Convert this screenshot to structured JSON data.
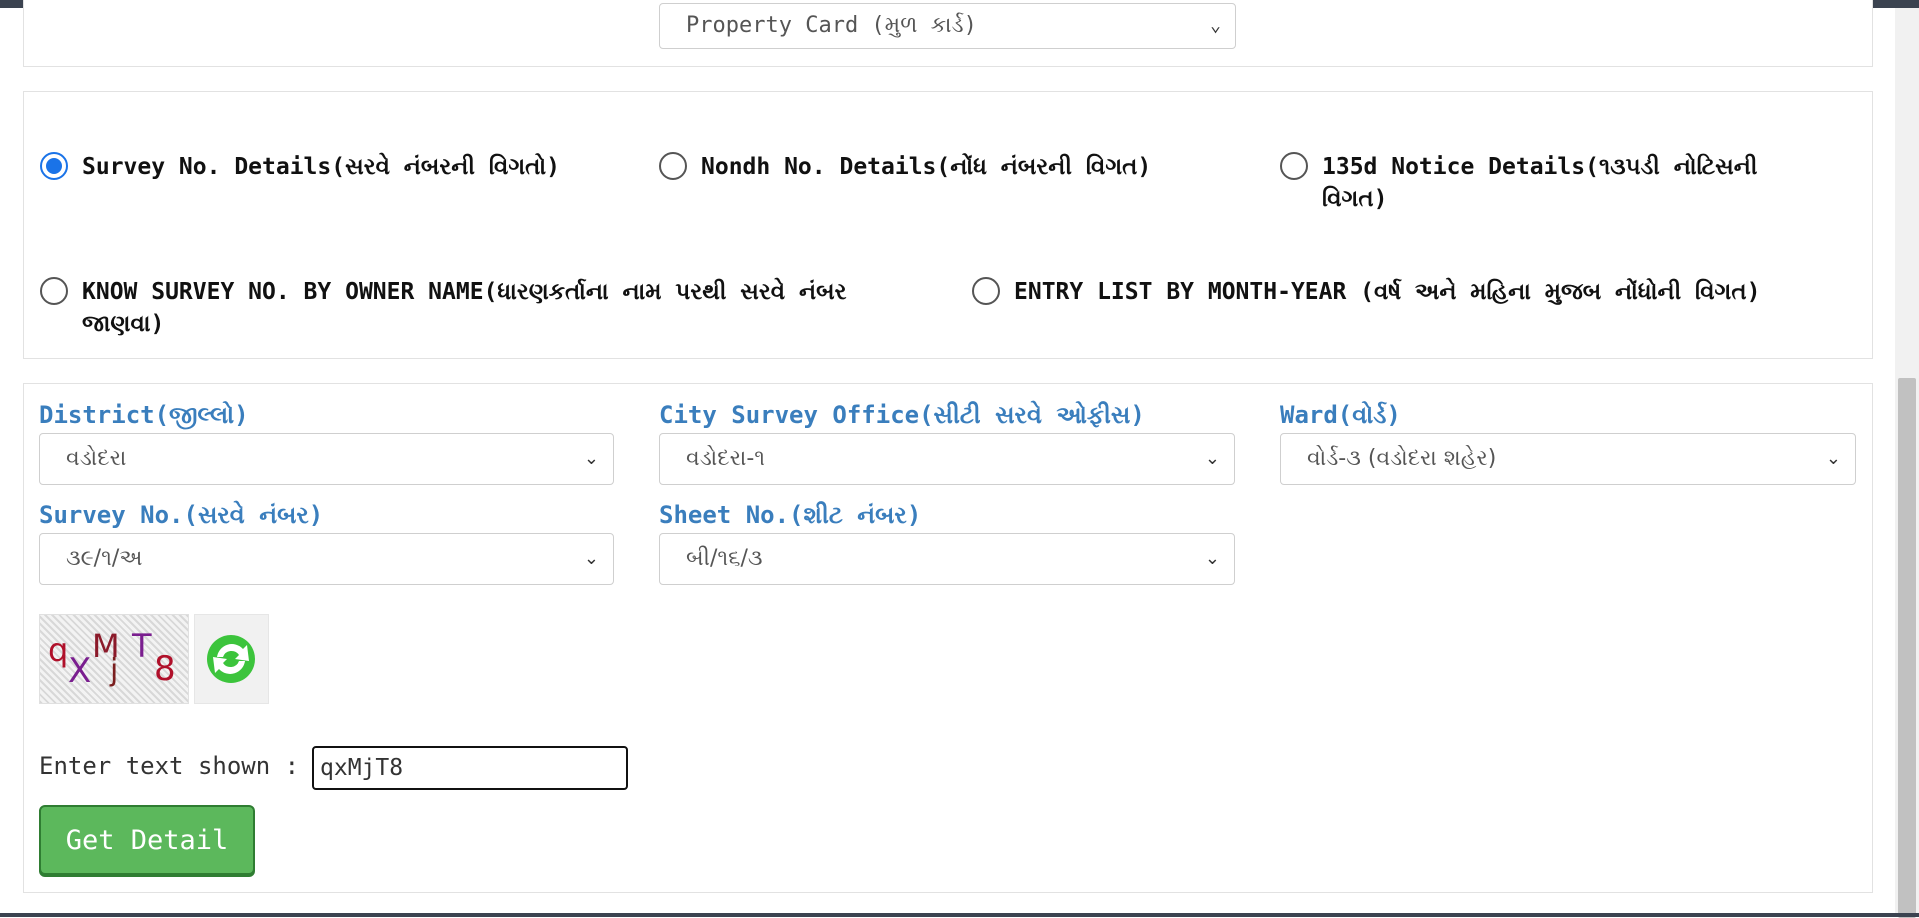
{
  "top": {
    "report_select": {
      "value": "Property Card (મુળ કાર્ડ)"
    }
  },
  "search_type": {
    "options": [
      {
        "label": "Survey No. Details(સરવે નંબરની વિગતો)",
        "checked": true
      },
      {
        "label": "Nondh No. Details(નોંધ નંબરની વિગત)",
        "checked": false
      },
      {
        "label": "135d Notice Details(૧૩૫ડી નોટિસની વિગત)",
        "checked": false
      },
      {
        "label": "KNOW SURVEY NO. BY OWNER NAME(ધારણકર્તાના નામ પરથી સરવે નંબર જાણવા)",
        "checked": false
      },
      {
        "label": "ENTRY LIST BY MONTH-YEAR (વર્ષ અને મહિના મુજબ નોંધોની વિગત)",
        "checked": false
      }
    ]
  },
  "form": {
    "district": {
      "label": "District(જીલ્લો)",
      "value": "વડોદરા"
    },
    "city_survey_office": {
      "label": "City Survey Office(સીટી સરવે ઓફીસ)",
      "value": "વડોદરા-૧"
    },
    "ward": {
      "label": "Ward(વોર્ડ)",
      "value": "વોર્ડ-૩ (વડોદરા શહેર)"
    },
    "survey_no": {
      "label": "Survey No.(સરવે નંબર)",
      "value": "૩૯/૧/અ"
    },
    "sheet_no": {
      "label": "Sheet No.(શીટ નંબર)",
      "value": "બી/૧૬/૩"
    }
  },
  "captcha": {
    "image_text": "qXMjT8",
    "refresh_icon": "refresh-icon",
    "enter_label": "Enter text shown :",
    "input_value": "qxMjT8"
  },
  "actions": {
    "get_detail_label": "Get Detail"
  },
  "colors": {
    "label_blue": "#3a7ebd",
    "radio_blue": "#1a73e8",
    "button_green": "#5cb85c"
  }
}
